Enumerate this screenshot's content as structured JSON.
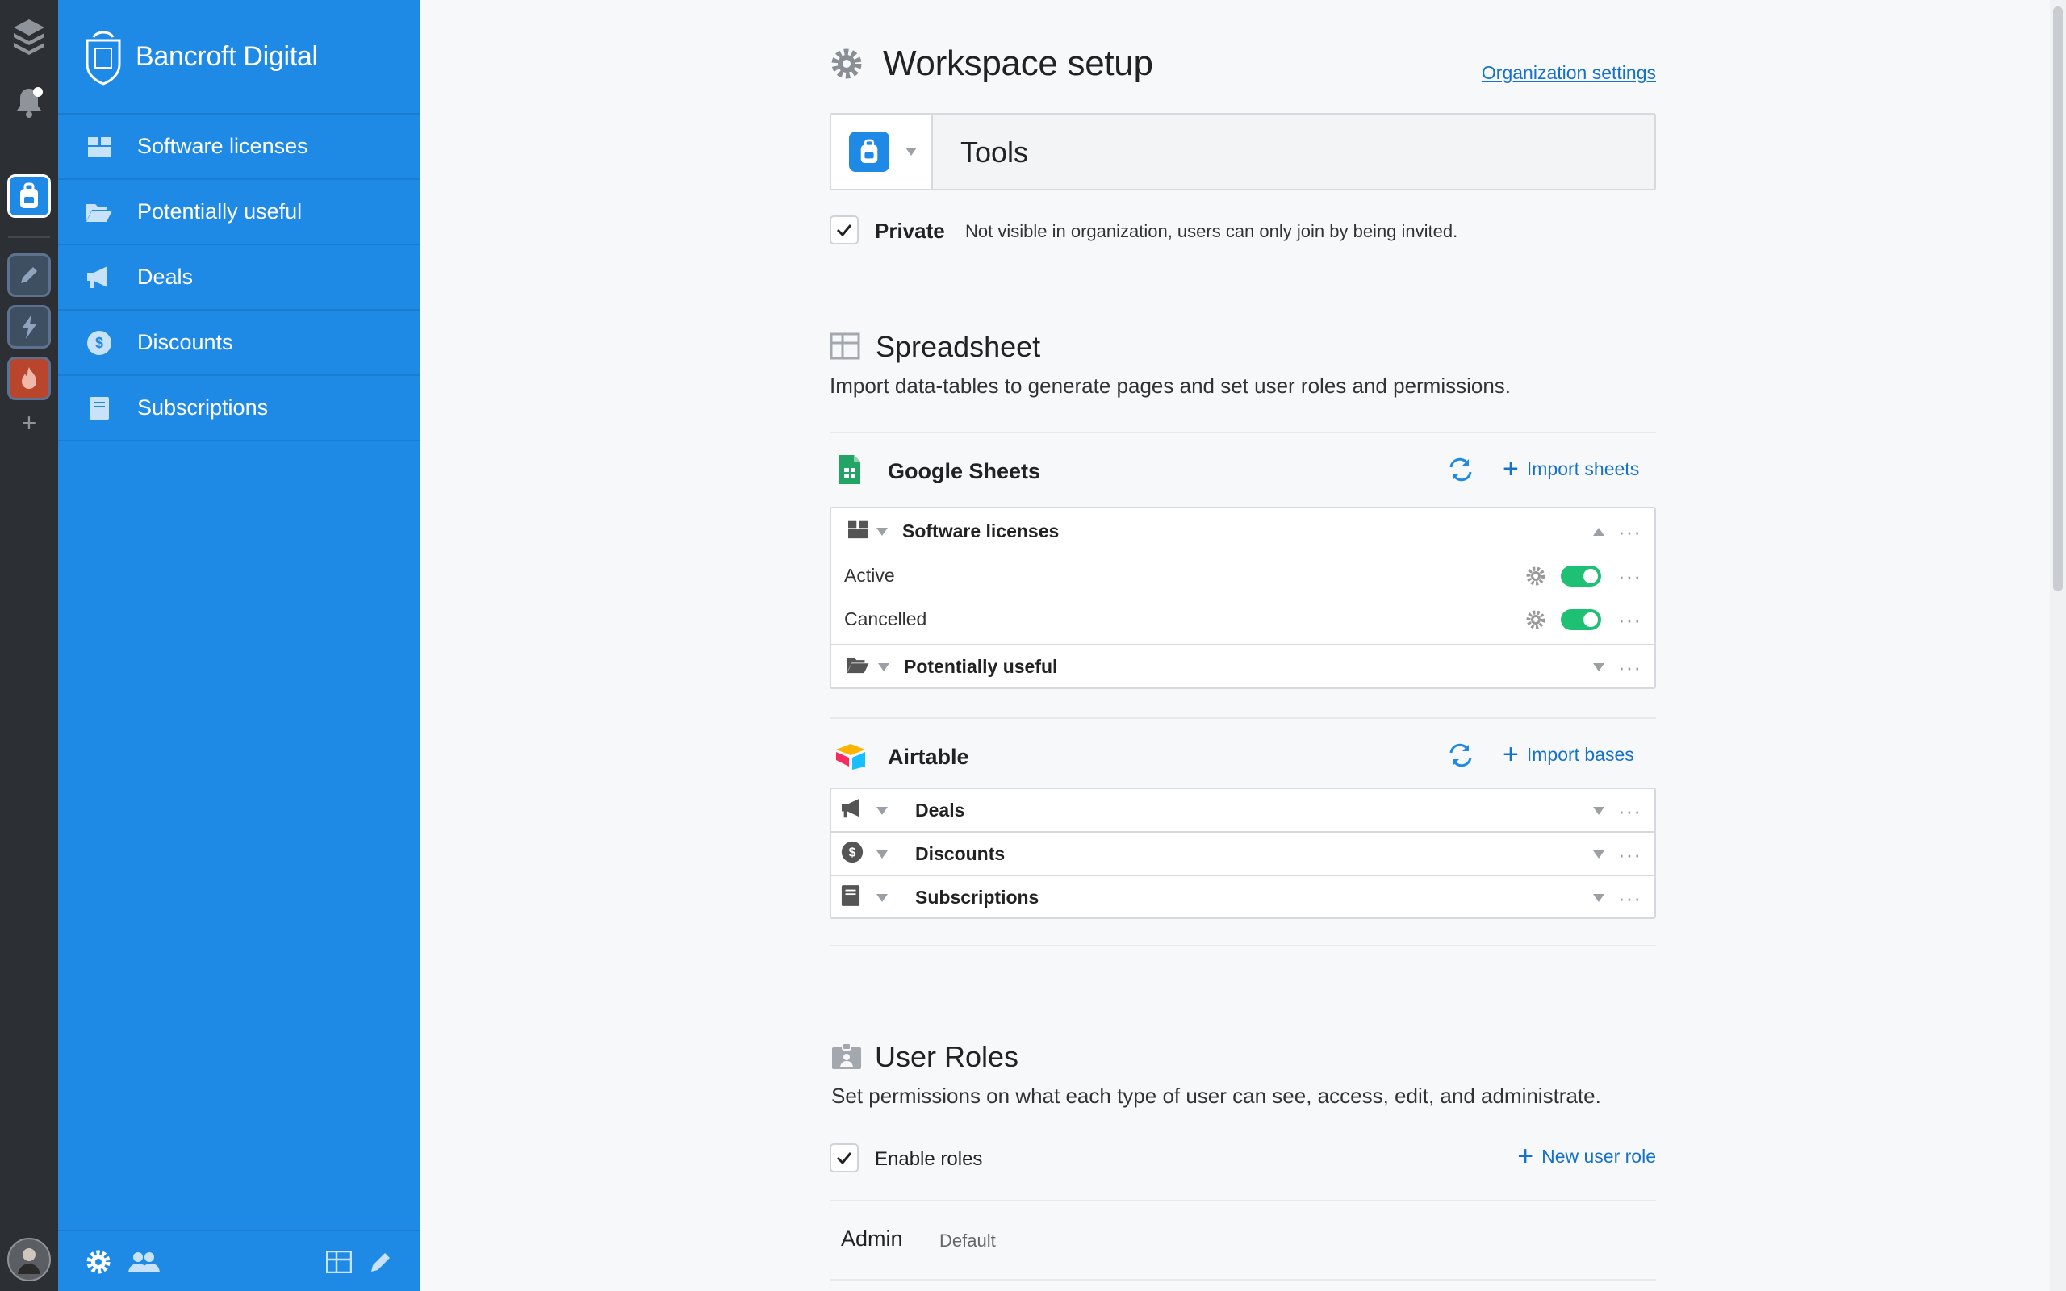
{
  "brand": {
    "name": "Bancroft Digital"
  },
  "sidebar": {
    "items": [
      {
        "label": "Software licenses",
        "icon": "box-icon"
      },
      {
        "label": "Potentially useful",
        "icon": "folder-open-icon"
      },
      {
        "label": "Deals",
        "icon": "megaphone-icon"
      },
      {
        "label": "Discounts",
        "icon": "dollar-badge-icon"
      },
      {
        "label": "Subscriptions",
        "icon": "book-icon"
      }
    ]
  },
  "header": {
    "title": "Workspace setup",
    "org_settings_link": "Organization settings"
  },
  "workspace": {
    "name": "Tools",
    "private_label": "Private",
    "private_desc": "Not visible in organization, users can only join by being invited."
  },
  "spreadsheet": {
    "title": "Spreadsheet",
    "desc": "Import data-tables to generate pages and set user roles and permissions.",
    "google": {
      "title": "Google Sheets",
      "import_label": "Import sheets",
      "tables": [
        {
          "name": "Software licenses",
          "views": [
            "Active",
            "Cancelled"
          ]
        },
        {
          "name": "Potentially useful"
        }
      ]
    },
    "airtable": {
      "title": "Airtable",
      "import_label": "Import bases",
      "tables": [
        "Deals",
        "Discounts",
        "Subscriptions"
      ]
    }
  },
  "roles": {
    "title": "User Roles",
    "desc": "Set permissions on what each type of user can see, access, edit, and administrate.",
    "enable_label": "Enable roles",
    "new_role_label": "New user role",
    "first_role": {
      "name": "Admin",
      "tag": "Default"
    }
  },
  "colors": {
    "sidebar": "#1f8ae6",
    "rail": "#2c2f33",
    "link": "#1672c9",
    "toggle_on": "#1ec173"
  }
}
